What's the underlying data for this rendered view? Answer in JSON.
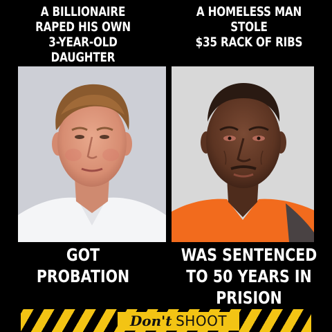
{
  "left_panel": {
    "top_caption": [
      "A BILLIONAIRE",
      "RAPED HIS OWN",
      "3-YEAR-OLD",
      "DAUGHTER"
    ],
    "bottom_caption": [
      "GOT",
      "PROBATION"
    ]
  },
  "right_panel": {
    "top_caption": [
      "A HOMELESS MAN",
      "STOLE",
      "$35 RACK OF RIBS"
    ],
    "bottom_caption": [
      "WAS SENTENCED",
      "TO 50 YEARS IN",
      "PRISION"
    ]
  },
  "banner": {
    "word1": "Don't",
    "word2": "SHOOT"
  },
  "colors": {
    "background": "#000000",
    "text": "#ffffff",
    "hazard_yellow": "#f3c414",
    "orange_shirt": "#f26b1d"
  }
}
